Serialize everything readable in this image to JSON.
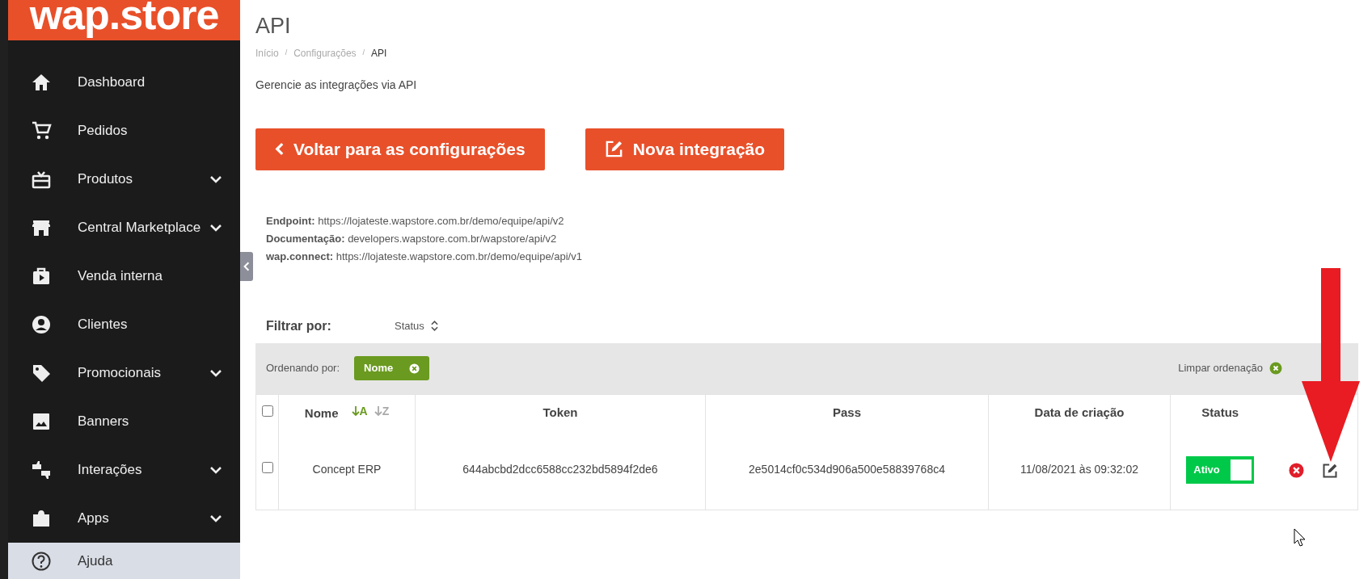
{
  "logo": "wap.store",
  "sidebar": {
    "items": [
      {
        "label": "Dashboard",
        "expandable": false
      },
      {
        "label": "Pedidos",
        "expandable": false
      },
      {
        "label": "Produtos",
        "expandable": true
      },
      {
        "label": "Central Marketplace",
        "expandable": true
      },
      {
        "label": "Venda interna",
        "expandable": false
      },
      {
        "label": "Clientes",
        "expandable": false
      },
      {
        "label": "Promocionais",
        "expandable": true
      },
      {
        "label": "Banners",
        "expandable": false
      },
      {
        "label": "Interações",
        "expandable": true
      },
      {
        "label": "Apps",
        "expandable": true
      }
    ],
    "help": "Ajuda"
  },
  "page": {
    "title": "API",
    "breadcrumb": [
      {
        "label": "Início",
        "separator": "/",
        "current": false
      },
      {
        "label": "Configurações",
        "separator": "/",
        "current": false
      },
      {
        "label": "API",
        "current": true
      }
    ],
    "description": "Gerencie as integrações via API"
  },
  "buttons": [
    {
      "label": "Voltar para as configurações",
      "kind": "back"
    },
    {
      "label": "Nova integração",
      "kind": "new"
    }
  ],
  "info": [
    {
      "label": "Endpoint:",
      "value": "https://lojateste.wapstore.com.br/demo/equipe/api/v2"
    },
    {
      "label": "Documentação:",
      "value": "developers.wapstore.com.br/wapstore/api/v2"
    },
    {
      "label": "wap.connect:",
      "value": "https://lojateste.wapstore.com.br/demo/equipe/api/v1"
    }
  ],
  "filter": {
    "label": "Filtrar por:",
    "field": "Status"
  },
  "sort": {
    "label": "Ordenando por:",
    "chips": [
      {
        "label": "Nome"
      }
    ],
    "clear": "Limpar ordenação"
  },
  "table": {
    "select_all": false,
    "columns": [
      {
        "label": "Nome",
        "sort_options": [
          {
            "label": "A",
            "selected": true
          },
          {
            "label": "Z",
            "selected": false
          }
        ]
      },
      {
        "label": "Token"
      },
      {
        "label": "Pass"
      },
      {
        "label": "Data de criação"
      },
      {
        "label": "Status"
      }
    ],
    "rows": [
      {
        "selected": false,
        "name": "Concept ERP",
        "token": "644abcbd2dcc6588cc232bd5894f2de6",
        "pass": "2e5014cf0c534d906a500e58839768c4",
        "created": "11/08/2021 às 09:32:02",
        "status": {
          "label": "Ativo",
          "on": true
        }
      }
    ]
  }
}
